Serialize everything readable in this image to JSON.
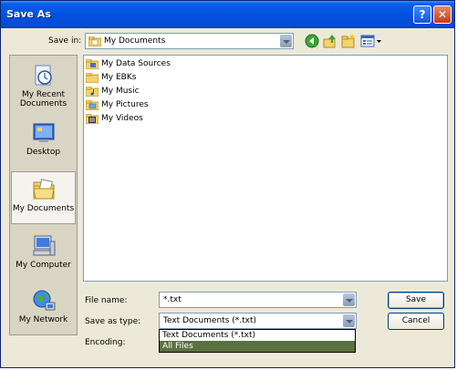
{
  "window": {
    "title": "Save As",
    "help_icon": "?",
    "close_icon": "✕"
  },
  "save_in": {
    "label": "Save in:",
    "value": "My Documents"
  },
  "toolbar": {
    "back_icon": "green-back-arrow-icon",
    "up_icon": "up-one-level-icon",
    "new_folder_icon": "new-folder-icon",
    "views_icon": "views-menu-icon"
  },
  "places": [
    {
      "name": "recent",
      "label": "My Recent Documents",
      "icon": "recent-documents-icon"
    },
    {
      "name": "desktop",
      "label": "Desktop",
      "icon": "desktop-icon"
    },
    {
      "name": "documents",
      "label": "My Documents",
      "icon": "my-documents-folder-icon",
      "selected": true
    },
    {
      "name": "computer",
      "label": "My Computer",
      "icon": "computer-icon"
    },
    {
      "name": "network",
      "label": "My Network",
      "icon": "network-globe-icon"
    }
  ],
  "files": [
    {
      "name": "My Data Sources",
      "icon": "data-sources-folder-icon"
    },
    {
      "name": "My EBKs",
      "icon": "folder-icon"
    },
    {
      "name": "My Music",
      "icon": "music-folder-icon"
    },
    {
      "name": "My Pictures",
      "icon": "pictures-folder-icon"
    },
    {
      "name": "My Videos",
      "icon": "videos-folder-icon"
    }
  ],
  "file_name": {
    "label": "File name:",
    "value": "*.txt"
  },
  "save_as_type": {
    "label": "Save as type:",
    "value": "Text Documents (*.txt)"
  },
  "encoding": {
    "label": "Encoding:"
  },
  "type_options": [
    "Text Documents (*.txt)",
    "All Files"
  ],
  "buttons": {
    "save": "Save",
    "cancel": "Cancel"
  },
  "colors": {
    "title_bar": "#0054e3",
    "dialog_bg": "#ece9d8",
    "highlight": "#5b7041"
  }
}
